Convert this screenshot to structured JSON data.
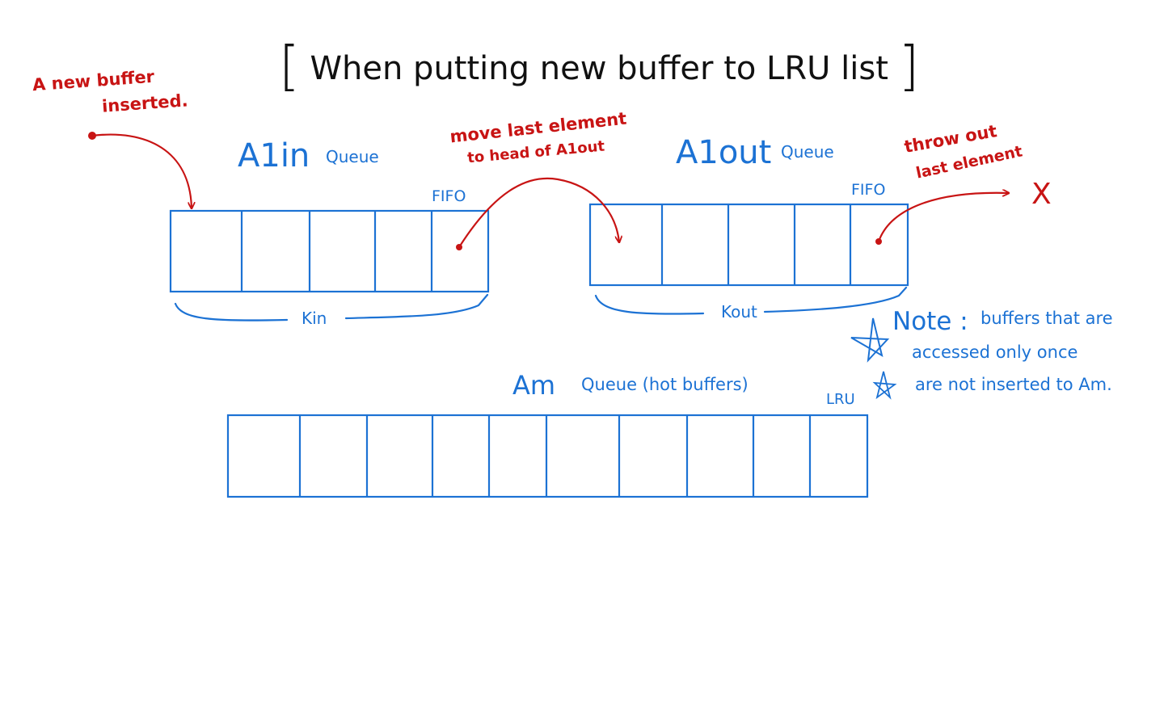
{
  "title": {
    "open_bracket": "[",
    "text": "When  putting new buffer to LRU list",
    "close_bracket": "]"
  },
  "annotations": {
    "new_buffer_line1": "A new buffer",
    "new_buffer_line2": "inserted.",
    "move_line1": "move last element",
    "move_line2": "to head of A1out",
    "throw_line1": "throw out",
    "throw_line2": "last element",
    "discard_mark": "X"
  },
  "queues": {
    "a1in": {
      "name": "A1in",
      "suffix": "Queue",
      "policy": "FIFO",
      "size_label": "Kin",
      "slots": 5
    },
    "a1out": {
      "name": "A1out",
      "suffix": "Queue",
      "policy": "FIFO",
      "size_label": "Kout",
      "slots": 5
    },
    "am": {
      "name": "Am",
      "suffix": "Queue (hot buffers)",
      "policy": "LRU",
      "slots": 10
    }
  },
  "note": {
    "line1_head": "Note :",
    "line1_rest": "buffers that are",
    "line2": "accessed only once",
    "line3": "are not inserted to Am."
  },
  "colors": {
    "ink": "#111111",
    "red": "#c81414",
    "blue": "#1c72d4"
  }
}
